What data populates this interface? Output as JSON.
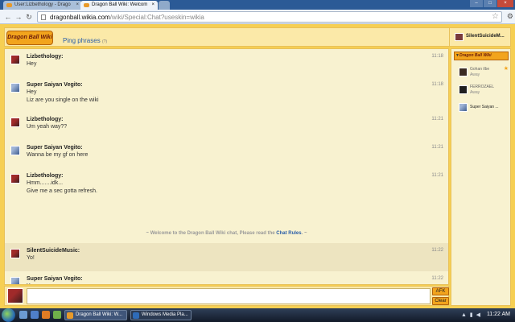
{
  "browser": {
    "tabs": [
      {
        "label": "User:Lizbethology - Drago"
      },
      {
        "label": "Dragon Ball Wiki: Welcom"
      }
    ],
    "url_host": "dragonball.wikia.com",
    "url_path": "/wiki/Special:Chat?useskin=wikia"
  },
  "header": {
    "logo_text": "Dragon Ball Wiki",
    "ping_label": "Ping phrases",
    "ping_count": "(?)",
    "user_name": "SilentSuicideM..."
  },
  "messages": [
    {
      "name": "Lizbethology:",
      "time": "11:18",
      "lines": [
        "Hey"
      ]
    },
    {
      "name": "Super Saiyan Vegito:",
      "time": "11:18",
      "lines": [
        "Hey",
        "Liz are you single on the wiki"
      ]
    },
    {
      "name": "Lizbethology:",
      "time": "11:21",
      "lines": [
        "Um yeah way??"
      ]
    },
    {
      "name": "Super Saiyan Vegito:",
      "time": "11:21",
      "lines": [
        "Wanna be my gf on here"
      ]
    },
    {
      "name": "Lizbethology:",
      "time": "11:21",
      "lines": [
        "Hmm.......idk...",
        "Give me a sec gotta refresh."
      ]
    },
    {
      "name": "SilentSuicideMusic:",
      "time": "11:22",
      "lines": [
        "Yo!"
      ]
    },
    {
      "name": "Super Saiyan Vegito:",
      "time": "11:22",
      "lines": [
        "Yo"
      ]
    }
  ],
  "welcome": {
    "text": "~ Welcome to the Dragon Ball Wiki chat, Please read the ",
    "link": "Chat Rules",
    "tail": ". ~"
  },
  "input": {
    "afk_label": "AFK",
    "clear_label": "Clear"
  },
  "sidebar": {
    "wiki_label": "Dragon Ball Wiki",
    "users": [
      {
        "name": "Gohan ilbe",
        "status": "Away",
        "star": "★"
      },
      {
        "name": "FERROZAEL",
        "status": "Away",
        "star": ""
      },
      {
        "name": "Super Saiyan ...",
        "status": "",
        "star": ""
      }
    ]
  },
  "taskbar": {
    "tasks": [
      {
        "label": "Dragon Ball Wiki: W..."
      },
      {
        "label": "Windows Media Pla..."
      }
    ],
    "clock": "11:22 AM"
  },
  "colors": {
    "page_bg": "#f6cf53",
    "chat_bg": "#f8f2d0",
    "link": "#2a5ea8",
    "button": "#f2a41d"
  }
}
